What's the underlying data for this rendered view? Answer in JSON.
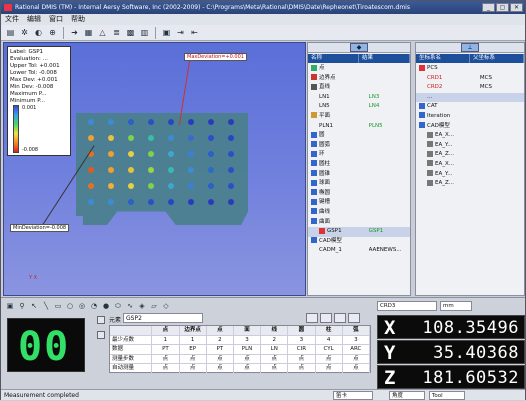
{
  "window": {
    "title": "Rational DMIS (TM) - Internal Aersy Software, Inc (2002-2009) - C:\\Programs\\Meta\\Rational\\DMIS\\Date\\Repheonet\\Tiroatescom.dmis",
    "buttons": [
      "_",
      "▢",
      "✕"
    ]
  },
  "menu": [
    "文件",
    "编辑",
    "窗口",
    "帮助"
  ],
  "viewport": {
    "info": {
      "lines": [
        "Label: GSP1",
        "Evaluation: ...",
        "Upper Tol: +0.001",
        "Lower Tol: -0.008",
        "Max Dev: +0.001",
        "Min Dev: -0.008",
        "Maximum P...",
        "Minimum P..."
      ],
      "legend_max": "0.001",
      "legend_min": "-0.008"
    },
    "max_callout": "MaxDeviation=+0.001",
    "min_callout": "MinDeviation=-0.008",
    "axes_label": "Y X"
  },
  "left_panel": {
    "columns": [
      "名称",
      "结果"
    ],
    "rows": [
      {
        "indent": 0,
        "label": "点",
        "value": "",
        "icon": "#3a6"
      },
      {
        "indent": 0,
        "label": "边界点",
        "value": "",
        "icon": "#c33"
      },
      {
        "indent": 0,
        "label": "直线",
        "value": "",
        "icon": "#555"
      },
      {
        "indent": 1,
        "label": "LN1",
        "value": "LN3",
        "icon": "",
        "value_color": "green"
      },
      {
        "indent": 1,
        "label": "LN5",
        "value": "LN4",
        "icon": "",
        "value_color": "green"
      },
      {
        "indent": 0,
        "label": "平面",
        "value": "",
        "icon": "#c93"
      },
      {
        "indent": 1,
        "label": "PLN1",
        "value": "PLN5",
        "icon": "",
        "value_color": "green"
      },
      {
        "indent": 0,
        "label": "圆",
        "value": "",
        "icon": "#36c"
      },
      {
        "indent": 0,
        "label": "圆弧",
        "value": "",
        "icon": "#36c"
      },
      {
        "indent": 0,
        "label": "环",
        "value": "",
        "icon": "#36c"
      },
      {
        "indent": 0,
        "label": "圆柱",
        "value": "",
        "icon": "#36c"
      },
      {
        "indent": 0,
        "label": "圆锥",
        "value": "",
        "icon": "#36c"
      },
      {
        "indent": 0,
        "label": "球面",
        "value": "",
        "icon": "#36c"
      },
      {
        "indent": 0,
        "label": "椭圆",
        "value": "",
        "icon": "#36c"
      },
      {
        "indent": 0,
        "label": "键槽",
        "value": "",
        "icon": "#36c"
      },
      {
        "indent": 0,
        "label": "曲线",
        "value": "",
        "icon": "#36c"
      },
      {
        "indent": 0,
        "label": "曲面",
        "value": "",
        "icon": "#36c"
      },
      {
        "indent": 1,
        "label": "GSP1",
        "value": "GSP1",
        "icon": "#d33",
        "selected": true,
        "value_color": "green"
      },
      {
        "indent": 0,
        "label": "CAD模型",
        "value": "",
        "icon": "#36c"
      },
      {
        "indent": 1,
        "label": "CADM_1",
        "value": "AAENEWS...",
        "icon": ""
      }
    ]
  },
  "right_panel": {
    "columns": [
      "坐标系名",
      "父坐标系"
    ],
    "rows": [
      {
        "indent": 0,
        "label": "PCS",
        "value": "",
        "icon": "#d33"
      },
      {
        "indent": 1,
        "label": "CRD1",
        "value": "MCS",
        "icon": "",
        "label_color": "red"
      },
      {
        "indent": 1,
        "label": "CRD2",
        "value": "MCS",
        "icon": "",
        "label_color": "red"
      },
      {
        "indent": 1,
        "label": "...",
        "value": "",
        "icon": "",
        "selected": true
      },
      {
        "indent": 0,
        "label": "CAT",
        "value": "",
        "icon": "#36c"
      },
      {
        "indent": 0,
        "label": "Iteration",
        "value": "",
        "icon": "#36c"
      },
      {
        "indent": 0,
        "label": "CAD模型",
        "value": "",
        "icon": "#36c"
      },
      {
        "indent": 1,
        "label": "EA_X...",
        "value": "",
        "icon": "#777"
      },
      {
        "indent": 1,
        "label": "EA_Y...",
        "value": "",
        "icon": "#777"
      },
      {
        "indent": 1,
        "label": "EA_Z...",
        "value": "",
        "icon": "#777"
      },
      {
        "indent": 1,
        "label": "EA_X...",
        "value": "",
        "icon": "#777"
      },
      {
        "indent": 1,
        "label": "EA_Y...",
        "value": "",
        "icon": "#777"
      },
      {
        "indent": 1,
        "label": "EA_Z...",
        "value": "",
        "icon": "#777"
      }
    ]
  },
  "bottom": {
    "counter": "00",
    "feature_label": "元素",
    "feature_name": "GSP2",
    "grid": {
      "headers": [
        "",
        "点",
        "边界点",
        "点",
        "面",
        "线",
        "圆",
        "柱",
        "弧"
      ],
      "rows": [
        [
          "最少点数",
          "1",
          "1",
          "2",
          "3",
          "2",
          "3",
          "4",
          "3"
        ],
        [
          "数据",
          "PT",
          "EP",
          "PT",
          "PLN",
          "LN",
          "CIR",
          "CYL",
          "ARC"
        ],
        [
          "测量步数",
          "点",
          "点",
          "点",
          "点",
          "点",
          "点",
          "点",
          "点"
        ],
        [
          "自动测量",
          "点",
          "点",
          "点",
          "点",
          "点",
          "点",
          "点",
          "点"
        ]
      ]
    }
  },
  "dro": {
    "coord_label": "CRD3",
    "unit": "mm",
    "axes": [
      {
        "axis": "X",
        "value": "108.35496"
      },
      {
        "axis": "Y",
        "value": "35.40368"
      },
      {
        "axis": "Z",
        "value": "181.60532"
      }
    ]
  },
  "status": {
    "text": "Measurement completed",
    "dd1": "笛卡",
    "dd2": "角度",
    "dd3": "Tool"
  },
  "dots": [
    [
      "#3a8cd6",
      "#3a8cd6",
      "#2a60c8",
      "#2a50c8",
      "#2a44c8",
      "#2a3ac0",
      "#2a3ac0",
      "#2a3ac0"
    ],
    [
      "#f0a030",
      "#e8c23a",
      "#7bd44a",
      "#37c0a0",
      "#3a8cd6",
      "#3a6ad0",
      "#2a50c8",
      "#2a44c8"
    ],
    [
      "#e67020",
      "#f0a030",
      "#e8d040",
      "#7bd44a",
      "#3aa8d0",
      "#3a80d6",
      "#2a60c8",
      "#2a50c8"
    ],
    [
      "#e05a20",
      "#f0a030",
      "#e8c23a",
      "#9ad44a",
      "#3ab8b8",
      "#3a8cd6",
      "#2a6ac8",
      "#2a50c8"
    ],
    [
      "#e67020",
      "#f0b030",
      "#e8d040",
      "#7bd44a",
      "#3aa8d0",
      "#3a80d6",
      "#2a60c8",
      "#2a50c8"
    ],
    [
      "#3a8cd6",
      "#3a8cd6",
      "#2a60c8",
      "#2a50c8",
      "#2a44c8",
      "#2a3ac0",
      "#2a3ac0",
      "#2a3ac0"
    ]
  ]
}
